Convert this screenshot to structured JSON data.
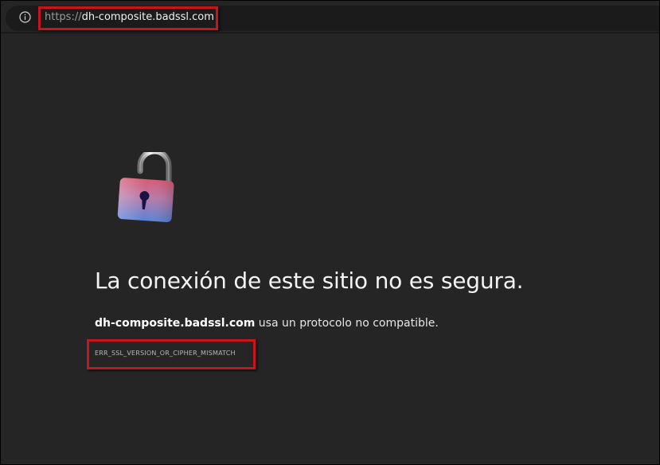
{
  "address_bar": {
    "scheme": "https://",
    "host": "dh-composite.badssl.com",
    "icon": "info-icon"
  },
  "error": {
    "icon": "broken-lock-icon",
    "title": "La conexión de este sitio no es segura.",
    "host": "dh-composite.badssl.com",
    "message": " usa un protocolo no compatible.",
    "code": "ERR_SSL_VERSION_OR_CIPHER_MISMATCH"
  },
  "colors": {
    "page_background": "#252526",
    "highlight": "#c8141e"
  }
}
